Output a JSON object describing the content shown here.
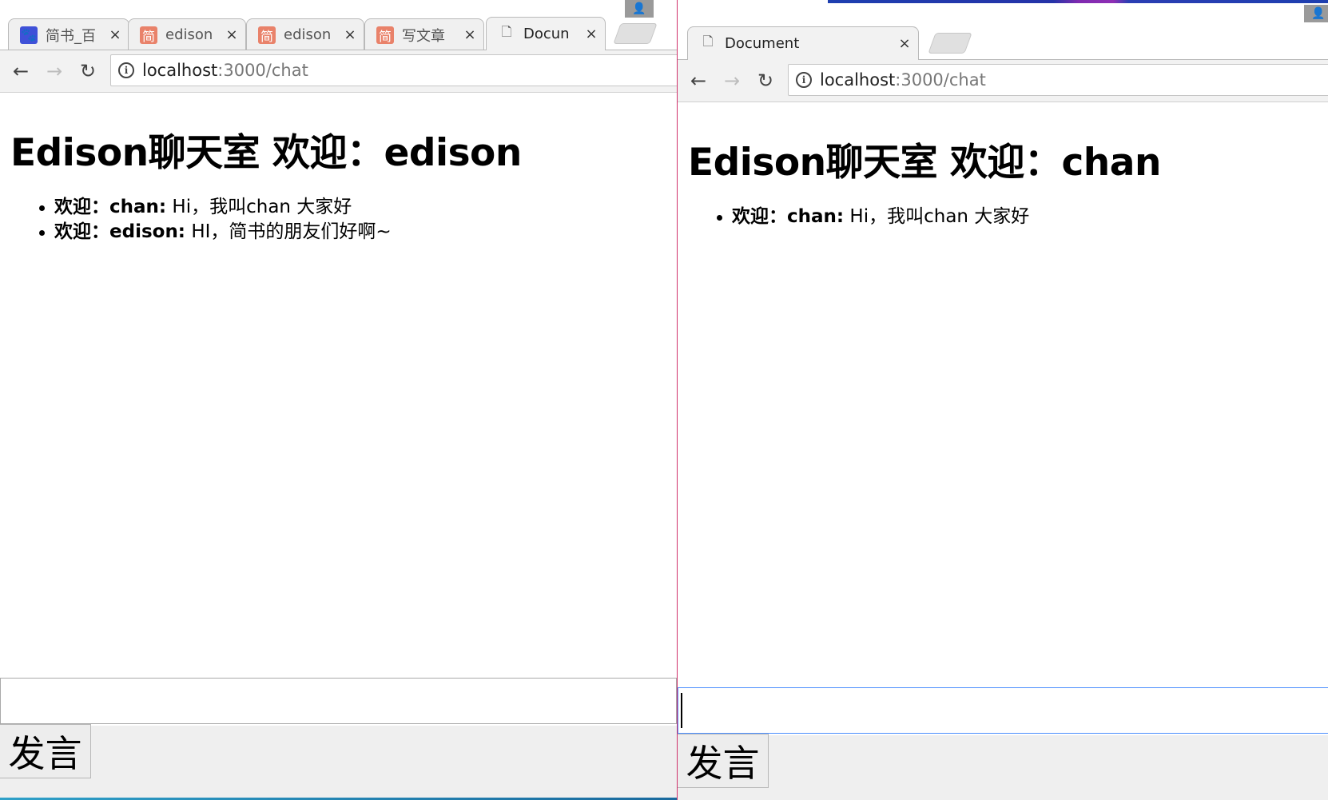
{
  "left_window": {
    "tabs": [
      {
        "title": "简书_百",
        "favicon": "baidu-paw-icon",
        "close": "×"
      },
      {
        "title": "edison",
        "favicon": "jianshu-icon",
        "close": "×"
      },
      {
        "title": "edison",
        "favicon": "jianshu-icon",
        "close": "×"
      },
      {
        "title": "写文章",
        "favicon": "jianshu-icon",
        "close": "×"
      },
      {
        "title": "Docun",
        "favicon": "document-icon",
        "close": "×"
      }
    ],
    "url_host": "localhost",
    "url_path": ":3000/chat",
    "heading": "Edison聊天室 欢迎：edison",
    "messages": [
      {
        "who": "欢迎：chan:",
        "text": " Hi，我叫chan 大家好"
      },
      {
        "who": "欢迎：edison:",
        "text": " HI，简书的朋友们好啊~"
      }
    ],
    "input_value": "",
    "send_label": "发言"
  },
  "right_window": {
    "tabs": [
      {
        "title": "Document",
        "favicon": "document-icon",
        "close": "×"
      }
    ],
    "url_host": "localhost",
    "url_path": ":3000/chat",
    "heading": "Edison聊天室 欢迎：chan",
    "messages": [
      {
        "who": "欢迎：chan:",
        "text": " Hi，我叫chan 大家好"
      }
    ],
    "input_value": "",
    "send_label": "发言"
  },
  "icons": {
    "back": "←",
    "forward": "→",
    "reload": "↻",
    "info": "i",
    "profile": "👤",
    "jianshu_glyph": "简",
    "baidu_glyph": "🐾",
    "document_glyph": "🗋"
  },
  "colors": {
    "tab_bg": "#f0f0f0",
    "jianshu_favicon": "#e9826a",
    "baidu_favicon": "#3f51d8",
    "focus_border": "#4d90fe",
    "window_border": "#d0306a"
  }
}
